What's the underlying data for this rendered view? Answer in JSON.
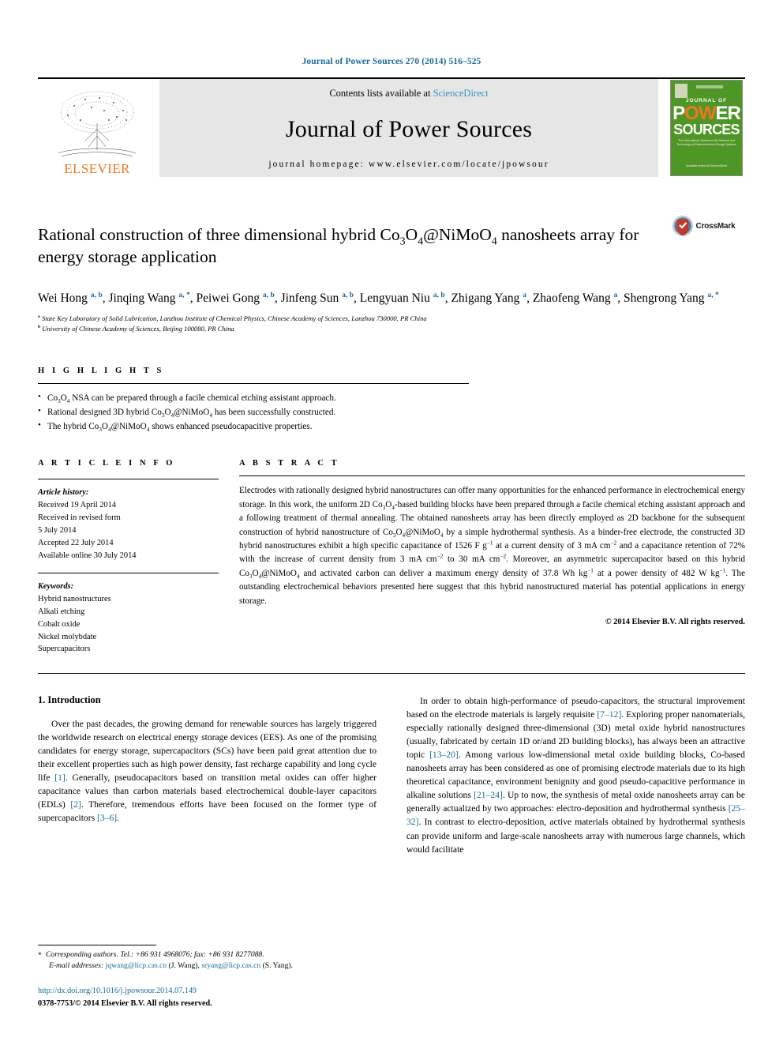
{
  "running_head": "Journal of Power Sources 270 (2014) 516–525",
  "masthead": {
    "contents_prefix": "Contents lists available at ",
    "sciencedirect": "ScienceDirect",
    "journal_title": "Journal of Power Sources",
    "homepage": "journal homepage: www.elsevier.com/locate/jpowsour",
    "publisher": "ELSEVIER",
    "cover": {
      "line1": "JOURNAL OF",
      "word_power": "POWER",
      "word_sources": "SOURCES",
      "subtitle": "The International Journal on the Science and Technology of Electrochemical Energy Systems",
      "footer": "Available online at ScienceDirect"
    },
    "accent_orange": "#ef7622",
    "accent_blue": "#3a8fc0",
    "banner_grey": "#e6e6e6",
    "cover_green": "#4e9625"
  },
  "article": {
    "title_line1_pre": "Rational construction of three dimensional hybrid Co",
    "title_formula": "Co3O4@NiMoO4",
    "title_line2": "nanosheets array for energy storage application",
    "crossmark_label": "CrossMark",
    "authors": [
      {
        "name": "Wei Hong",
        "marks": "a, b"
      },
      {
        "name": "Jinqing Wang",
        "marks": "a, *"
      },
      {
        "name": "Peiwei Gong",
        "marks": "a, b"
      },
      {
        "name": "Jinfeng Sun",
        "marks": "a, b"
      },
      {
        "name": "Lengyuan Niu",
        "marks": "a, b"
      },
      {
        "name": "Zhigang Yang",
        "marks": "a"
      },
      {
        "name": "Zhaofeng Wang",
        "marks": "a"
      },
      {
        "name": "Shengrong Yang",
        "marks": "a, *"
      }
    ],
    "affiliations": [
      {
        "mark": "a",
        "text": "State Key Laboratory of Solid Lubrication, Lanzhou Institute of Chemical Physics, Chinese Academy of Sciences, Lanzhou 730000, PR China"
      },
      {
        "mark": "b",
        "text": "University of Chinese Academy of Sciences, Beijing 100080, PR China"
      }
    ]
  },
  "highlights": {
    "label": "H I G H L I G H T S",
    "items": [
      "Co3O4 NSA can be prepared through a facile chemical etching assistant approach.",
      "Rational designed 3D hybrid Co3O4@NiMoO4 has been successfully constructed.",
      "The hybrid Co3O4@NiMoO4 shows enhanced pseudocapacitive properties."
    ]
  },
  "article_info": {
    "label": "A R T I C L E   I N F O",
    "history_header": "Article history:",
    "history": [
      "Received 19 April 2014",
      "Received in revised form",
      "5 July 2014",
      "Accepted 22 July 2014",
      "Available online 30 July 2014"
    ],
    "keywords_header": "Keywords:",
    "keywords": [
      "Hybrid nanostructures",
      "Alkali etching",
      "Cobalt oxide",
      "Nickel molybdate",
      "Supercapacitors"
    ]
  },
  "abstract": {
    "label": "A B S T R A C T",
    "text": "Electrodes with rationally designed hybrid nanostructures can offer many opportunities for the enhanced performance in electrochemical energy storage. In this work, the uniform 2D Co3O4-based building blocks have been prepared through a facile chemical etching assistant approach and a following treatment of thermal annealing. The obtained nanosheets array has been directly employed as 2D backbone for the subsequent construction of hybrid nanostructure of Co3O4@NiMoO4 by a simple hydrothermal synthesis. As a binder-free electrode, the constructed 3D hybrid nanostructures exhibit a high specific capacitance of 1526 F g-1 at a current density of 3 mA cm-2 and a capacitance retention of 72% with the increase of current density from 3 mA cm-2 to 30 mA cm-2. Moreover, an asymmetric supercapacitor based on this hybrid Co3O4@NiMoO4 and activated carbon can deliver a maximum energy density of 37.8 Wh kg-1 at a power density of 482 W kg-1. The outstanding electrochemical behaviors presented here suggest that this hybrid nanostructured material has potential applications in energy storage.",
    "copyright": "© 2014 Elsevier B.V. All rights reserved."
  },
  "body": {
    "section_number_title": "1.  Introduction",
    "left_paragraph": "Over the past decades, the growing demand for renewable sources has largely triggered the worldwide research on electrical energy storage devices (EES). As one of the promising candidates for energy storage, supercapacitors (SCs) have been paid great attention due to their excellent properties such as high power density, fast recharge capability and long cycle life [1]. Generally, pseudocapacitors based on transition metal oxides can offer higher capacitance values than carbon materials based electrochemical double-layer capacitors (EDLs) [2]. Therefore, tremendous efforts have been focused on the former type of supercapacitors [3–6].",
    "right_paragraph": "In order to obtain high-performance of pseudo-capacitors, the structural improvement based on the electrode materials is largely requisite [7–12]. Exploring proper nanomaterials, especially rationally designed three-dimensional (3D) metal oxide hybrid nanostructures (usually, fabricated by certain 1D or/and 2D building blocks), has always been an attractive topic [13–20]. Among various low-dimensional metal oxide building blocks, Co-based nanosheets array has been considered as one of promising electrode materials due to its high theoretical capacitance, environment benignity and good pseudo-capacitive performance in alkaline solutions [21–24]. Up to now, the synthesis of metal oxide nanosheets array can be generally actualized by two approaches: electro-deposition and hydrothermal synthesis [25–32]. In contrast to electro-deposition, active materials obtained by hydrothermal synthesis can provide uniform and large-scale nanosheets array with numerous large channels, which would facilitate"
  },
  "footnotes": {
    "corresponding": "Corresponding authors. Tel.: +86 931 4968076; fax: +86 931 8277088.",
    "email_label": "E-mail addresses:",
    "email1": "jqwang@licp.cas.cn",
    "email1_name": "(J. Wang),",
    "email2": "sryang@licp.cas.cn",
    "email2_name": "(S. Yang).",
    "doi": "http://dx.doi.org/10.1016/j.jpowsour.2014.07.149",
    "issn": "0378-7753/© 2014 Elsevier B.V. All rights reserved."
  }
}
